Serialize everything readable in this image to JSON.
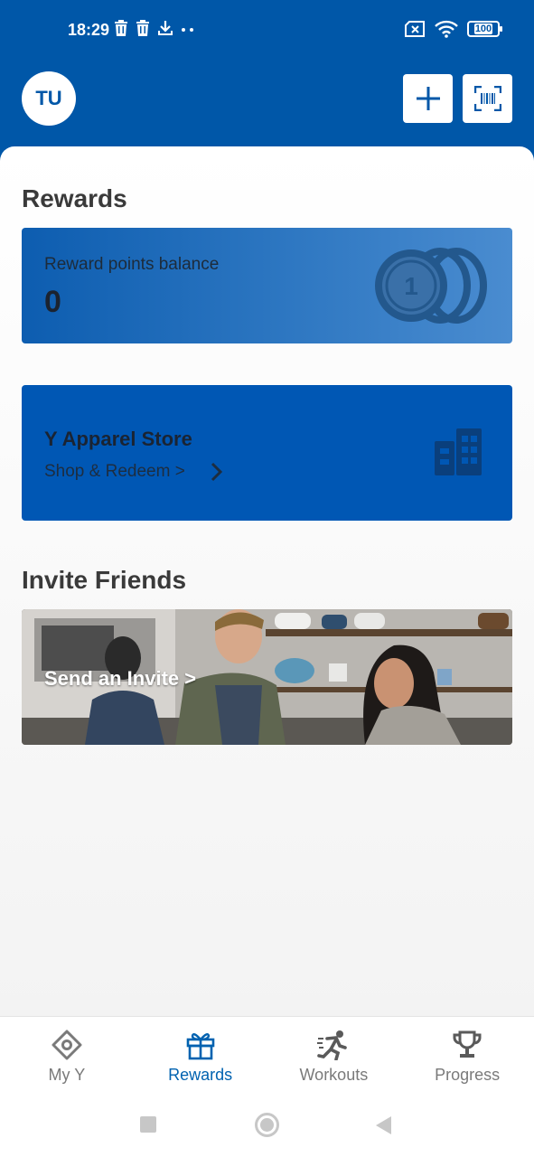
{
  "status_bar": {
    "time": "18:29",
    "battery": "100"
  },
  "header": {
    "avatar_initials": "TU"
  },
  "rewards": {
    "section_title": "Rewards",
    "points_label": "Reward points balance",
    "points_value": "0",
    "coin_digit": "1"
  },
  "store": {
    "title": "Y Apparel Store",
    "subtitle": "Shop & Redeem >"
  },
  "invite": {
    "section_title": "Invite Friends",
    "cta": "Send an Invite >"
  },
  "bottom_nav": {
    "items": [
      {
        "label": "My Y",
        "icon": "target-icon"
      },
      {
        "label": "Rewards",
        "icon": "gift-icon"
      },
      {
        "label": "Workouts",
        "icon": "runner-icon"
      },
      {
        "label": "Progress",
        "icon": "trophy-icon"
      }
    ],
    "active_index": 1
  },
  "colors": {
    "brand_blue": "#0057a8",
    "active_nav": "#0062b0",
    "inactive_nav": "#7a7a7a"
  }
}
